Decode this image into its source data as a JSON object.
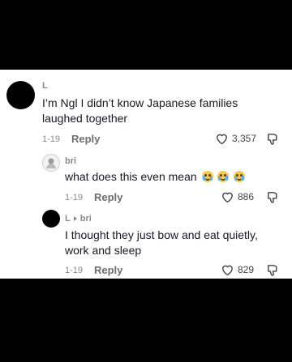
{
  "comments": [
    {
      "username": "L",
      "text": "I’m Ngl I didn’t know Japanese families laughed together",
      "date": "1-19",
      "reply_label": "Reply",
      "likes": "3,357"
    },
    {
      "username": "bri",
      "text": "what does this even mean",
      "emojis": [
        "laughing-crying",
        "laughing-crying",
        "laughing-crying"
      ],
      "date": "1-19",
      "reply_label": "Reply",
      "likes": "886"
    },
    {
      "username": "L",
      "reply_to": "bri",
      "text": "I thought they just bow and eat quietly, work and sleep",
      "date": "1-19",
      "reply_label": "Reply",
      "likes": "829"
    }
  ],
  "colors": {
    "background_outer": "#000000",
    "card_background": "#ffffff",
    "text_primary": "#161823",
    "text_secondary": "#8a8a8a"
  }
}
